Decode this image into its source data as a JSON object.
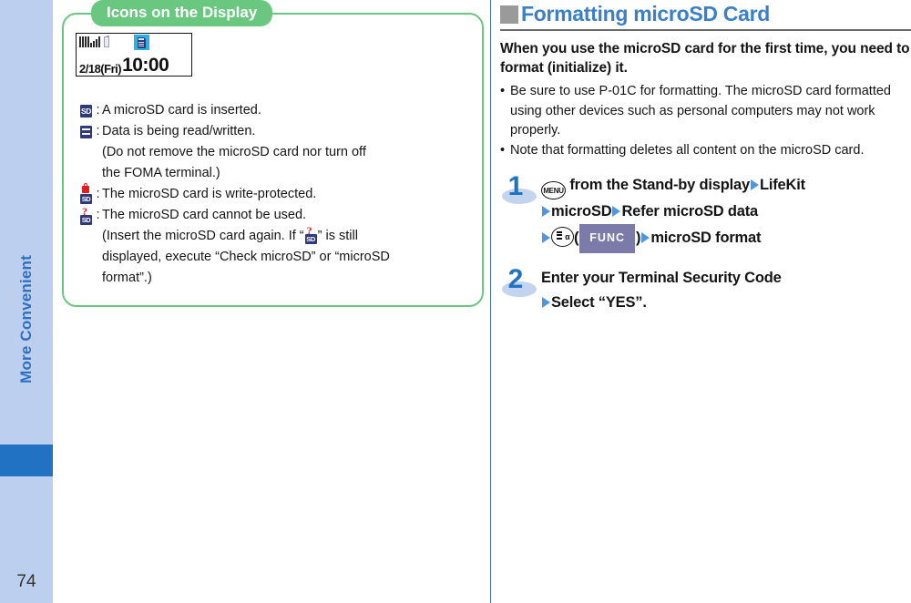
{
  "sidebar": {
    "chapter_label": "More Convenient",
    "page_number": "74",
    "colors": {
      "background": "#bdcfee",
      "marker": "#2272c4",
      "text": "#2d6fc4"
    }
  },
  "left_column": {
    "tip_box": {
      "title": "Icons on the Display",
      "accent_color": "#6ac77f",
      "phone_mock": {
        "date": "2/18(Fri)",
        "time": "10:00",
        "status_icons": [
          "signal-bars-icon",
          "antenna-icon",
          "battery-icon",
          "microsd-icon"
        ],
        "highlight_color": "#29b2e8"
      },
      "legend": [
        {
          "icon": "microsd-inserted-icon",
          "icon_label": "SD",
          "separator": ":",
          "text": "A microSD card is inserted.",
          "continuation": []
        },
        {
          "icon": "microsd-readwrite-icon",
          "icon_label": "",
          "separator": ":",
          "text": "Data is being read/written.",
          "continuation": [
            "(Do not remove the microSD card nor turn off",
            "the FOMA terminal.)"
          ]
        },
        {
          "icon": "microsd-write-protected-icon",
          "icon_label": "SD",
          "separator": ":",
          "text": "The microSD card is write-protected.",
          "continuation": []
        },
        {
          "icon": "microsd-unusable-icon",
          "icon_label": "SD",
          "separator": ":",
          "text": "The microSD card cannot be used.",
          "continuation_rich": {
            "line1_a": "(Insert the microSD card again. If “",
            "line1_b": "” is still",
            "line2": "displayed, execute “Check microSD” or “microSD",
            "line3": "format”.)"
          }
        }
      ]
    }
  },
  "right_column": {
    "section": {
      "marker_color": "#9a9a9a",
      "title": "Formatting microSD Card",
      "title_color": "#3a7fc8"
    },
    "intro": "When you use the microSD card for the first time, you need to format (initialize) it.",
    "bullets": [
      "Be sure to use P-01C for formatting. The microSD card formatted using other devices such as personal computers may not work properly.",
      "Note that formatting deletes all content on the microSD card."
    ],
    "steps": [
      {
        "number": "1",
        "line1_key": "MENU",
        "line1_a": "from the Stand-by display",
        "line1_b": "LifeKit",
        "line2_a": "microSD",
        "line2_b": "Refer microSD data",
        "line3_key": "func-key-icon",
        "line3_paren_open": "(",
        "line3_chip": "FUNC",
        "line3_paren_close": ")",
        "line3_b": "microSD format"
      },
      {
        "number": "2",
        "line1": "Enter your Terminal Security Code",
        "line2": "Select “YES”."
      }
    ]
  }
}
